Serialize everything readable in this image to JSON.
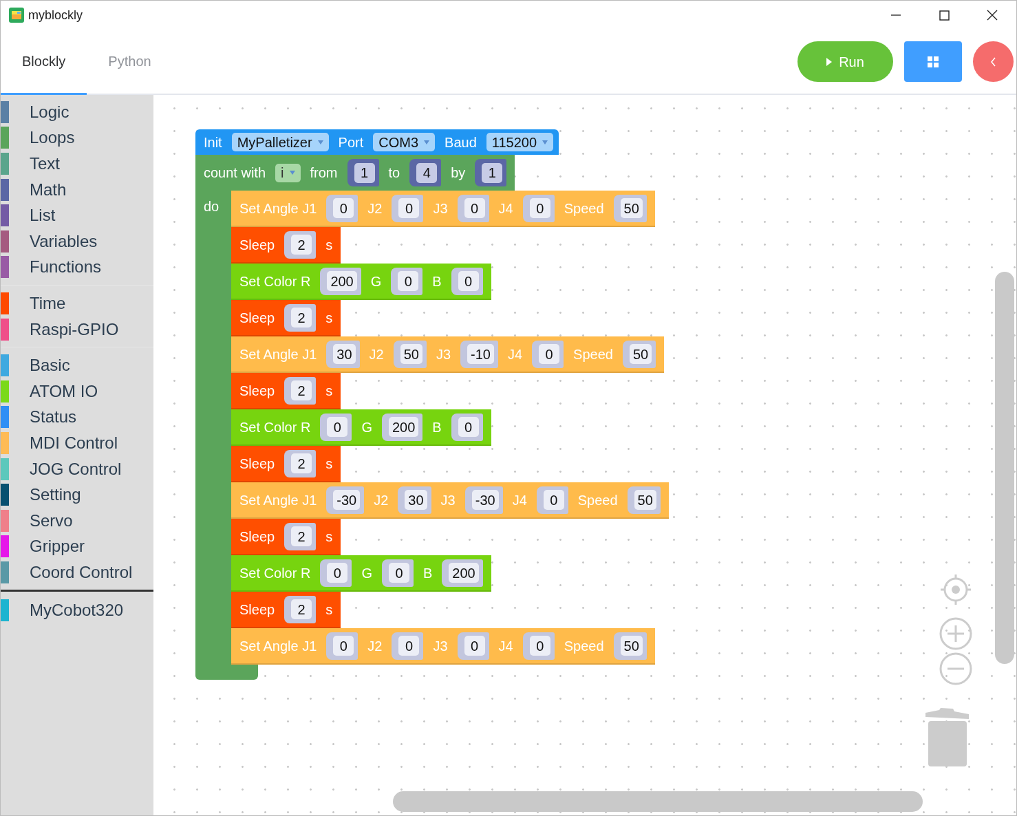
{
  "window": {
    "title": "myblockly"
  },
  "tabs": [
    {
      "label": "Blockly",
      "selected": true
    },
    {
      "label": "Python",
      "selected": false
    }
  ],
  "toolbar": {
    "run_label": "Run"
  },
  "sidebar": {
    "groups": [
      {
        "items": [
          {
            "label": "Logic",
            "color": "#5b80a5"
          },
          {
            "label": "Loops",
            "color": "#5ba55b"
          },
          {
            "label": "Text",
            "color": "#5ba58c"
          },
          {
            "label": "Math",
            "color": "#5b67a5"
          },
          {
            "label": "List",
            "color": "#745ba5"
          },
          {
            "label": "Variables",
            "color": "#a55b80"
          },
          {
            "label": "Functions",
            "color": "#995ba5"
          }
        ]
      },
      {
        "items": [
          {
            "label": "Time",
            "color": "#fe4a00"
          },
          {
            "label": "Raspi-GPIO",
            "color": "#ef4f89"
          }
        ]
      },
      {
        "items": [
          {
            "label": "Basic",
            "color": "#3fa9e0"
          },
          {
            "label": "ATOM IO",
            "color": "#7ad91a"
          },
          {
            "label": "Status",
            "color": "#2f8ff5"
          },
          {
            "label": "MDI Control",
            "color": "#ffbb55"
          },
          {
            "label": "JOG Control",
            "color": "#5cc8bc"
          },
          {
            "label": "Setting",
            "color": "#075070"
          },
          {
            "label": "Servo",
            "color": "#ef7f8a"
          },
          {
            "label": "Gripper",
            "color": "#e617e9"
          },
          {
            "label": "Coord Control",
            "color": "#5a99a6"
          }
        ]
      }
    ],
    "robot_groups": [
      {
        "items": [
          {
            "label": "MyCobot320",
            "color": "#1cb4d0"
          }
        ]
      }
    ]
  },
  "workspace": {
    "init_block": {
      "parts": [
        {
          "kind": "text",
          "text": "Init"
        },
        {
          "kind": "dropdown",
          "text": "MyPalletizer"
        },
        {
          "kind": "text",
          "text": "Port"
        },
        {
          "kind": "dropdown",
          "text": "COM3"
        },
        {
          "kind": "text",
          "text": "Baud"
        },
        {
          "kind": "dropdown",
          "text": "115200"
        }
      ]
    },
    "loop_block": {
      "parts": [
        {
          "kind": "text",
          "text": "count with"
        },
        {
          "kind": "dropdown",
          "text": "i"
        },
        {
          "kind": "text",
          "text": "from"
        },
        {
          "kind": "number",
          "text": "1"
        },
        {
          "kind": "text",
          "text": "to"
        },
        {
          "kind": "number",
          "text": "4"
        },
        {
          "kind": "text",
          "text": "by"
        },
        {
          "kind": "number",
          "text": "1"
        }
      ],
      "do_label": "do",
      "body": [
        {
          "kind": "set_angle",
          "parts": [
            {
              "kind": "text",
              "text": "Set Angle J1"
            },
            {
              "kind": "number",
              "text": "0"
            },
            {
              "kind": "text",
              "text": "J2"
            },
            {
              "kind": "number",
              "text": "0"
            },
            {
              "kind": "text",
              "text": "J3"
            },
            {
              "kind": "number",
              "text": "0"
            },
            {
              "kind": "text",
              "text": "J4"
            },
            {
              "kind": "number",
              "text": "0"
            },
            {
              "kind": "text",
              "text": "Speed"
            },
            {
              "kind": "number",
              "text": "50"
            }
          ]
        },
        {
          "kind": "sleep",
          "parts": [
            {
              "kind": "text",
              "text": "Sleep"
            },
            {
              "kind": "number",
              "text": "2"
            },
            {
              "kind": "text",
              "text": "s"
            }
          ]
        },
        {
          "kind": "set_color",
          "parts": [
            {
              "kind": "text",
              "text": "Set Color R"
            },
            {
              "kind": "number",
              "text": "200"
            },
            {
              "kind": "text",
              "text": "G"
            },
            {
              "kind": "number",
              "text": "0"
            },
            {
              "kind": "text",
              "text": "B"
            },
            {
              "kind": "number",
              "text": "0"
            }
          ]
        },
        {
          "kind": "sleep",
          "parts": [
            {
              "kind": "text",
              "text": "Sleep"
            },
            {
              "kind": "number",
              "text": "2"
            },
            {
              "kind": "text",
              "text": "s"
            }
          ]
        },
        {
          "kind": "set_angle",
          "parts": [
            {
              "kind": "text",
              "text": "Set Angle J1"
            },
            {
              "kind": "number",
              "text": "30"
            },
            {
              "kind": "text",
              "text": "J2"
            },
            {
              "kind": "number",
              "text": "50"
            },
            {
              "kind": "text",
              "text": "J3"
            },
            {
              "kind": "number",
              "text": "-10"
            },
            {
              "kind": "text",
              "text": "J4"
            },
            {
              "kind": "number",
              "text": "0"
            },
            {
              "kind": "text",
              "text": "Speed"
            },
            {
              "kind": "number",
              "text": "50"
            }
          ]
        },
        {
          "kind": "sleep",
          "parts": [
            {
              "kind": "text",
              "text": "Sleep"
            },
            {
              "kind": "number",
              "text": "2"
            },
            {
              "kind": "text",
              "text": "s"
            }
          ]
        },
        {
          "kind": "set_color",
          "parts": [
            {
              "kind": "text",
              "text": "Set Color R"
            },
            {
              "kind": "number",
              "text": "0"
            },
            {
              "kind": "text",
              "text": "G"
            },
            {
              "kind": "number",
              "text": "200"
            },
            {
              "kind": "text",
              "text": "B"
            },
            {
              "kind": "number",
              "text": "0"
            }
          ]
        },
        {
          "kind": "sleep",
          "parts": [
            {
              "kind": "text",
              "text": "Sleep"
            },
            {
              "kind": "number",
              "text": "2"
            },
            {
              "kind": "text",
              "text": "s"
            }
          ]
        },
        {
          "kind": "set_angle",
          "parts": [
            {
              "kind": "text",
              "text": "Set Angle J1"
            },
            {
              "kind": "number",
              "text": "-30"
            },
            {
              "kind": "text",
              "text": "J2"
            },
            {
              "kind": "number",
              "text": "30"
            },
            {
              "kind": "text",
              "text": "J3"
            },
            {
              "kind": "number",
              "text": "-30"
            },
            {
              "kind": "text",
              "text": "J4"
            },
            {
              "kind": "number",
              "text": "0"
            },
            {
              "kind": "text",
              "text": "Speed"
            },
            {
              "kind": "number",
              "text": "50"
            }
          ]
        },
        {
          "kind": "sleep",
          "parts": [
            {
              "kind": "text",
              "text": "Sleep"
            },
            {
              "kind": "number",
              "text": "2"
            },
            {
              "kind": "text",
              "text": "s"
            }
          ]
        },
        {
          "kind": "set_color",
          "parts": [
            {
              "kind": "text",
              "text": "Set Color R"
            },
            {
              "kind": "number",
              "text": "0"
            },
            {
              "kind": "text",
              "text": "G"
            },
            {
              "kind": "number",
              "text": "0"
            },
            {
              "kind": "text",
              "text": "B"
            },
            {
              "kind": "number",
              "text": "200"
            }
          ]
        },
        {
          "kind": "sleep",
          "parts": [
            {
              "kind": "text",
              "text": "Sleep"
            },
            {
              "kind": "number",
              "text": "2"
            },
            {
              "kind": "text",
              "text": "s"
            }
          ]
        },
        {
          "kind": "set_angle",
          "parts": [
            {
              "kind": "text",
              "text": "Set Angle J1"
            },
            {
              "kind": "number",
              "text": "0"
            },
            {
              "kind": "text",
              "text": "J2"
            },
            {
              "kind": "number",
              "text": "0"
            },
            {
              "kind": "text",
              "text": "J3"
            },
            {
              "kind": "number",
              "text": "0"
            },
            {
              "kind": "text",
              "text": "J4"
            },
            {
              "kind": "number",
              "text": "0"
            },
            {
              "kind": "text",
              "text": "Speed"
            },
            {
              "kind": "number",
              "text": "50"
            }
          ]
        }
      ]
    }
  }
}
